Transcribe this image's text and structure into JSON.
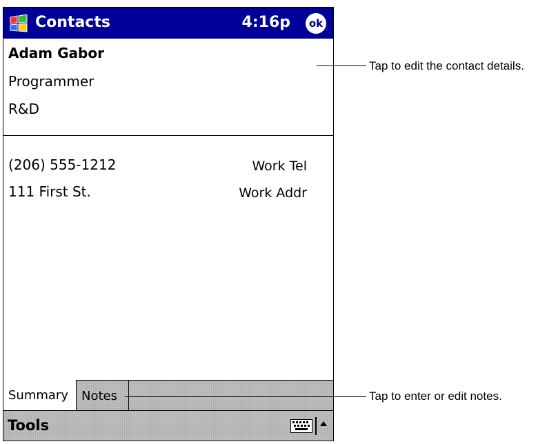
{
  "titlebar": {
    "app_title": "Contacts",
    "time": "4:16p",
    "ok_label": "ok"
  },
  "contact": {
    "name": "Adam Gabor",
    "job_title": "Programmer",
    "department": "R&D"
  },
  "fields": [
    {
      "value": "(206) 555-1212",
      "label": "Work Tel"
    },
    {
      "value": "111 First St.",
      "label": "Work Addr"
    }
  ],
  "tabs": [
    {
      "label": "Summary",
      "selected": true
    },
    {
      "label": "Notes",
      "selected": false
    }
  ],
  "command_bar": {
    "tools_label": "Tools",
    "keyboard_icon": "keyboard-icon",
    "arrow_icon": "up-arrow-icon"
  },
  "callouts": [
    {
      "text": "Tap to edit the contact details."
    },
    {
      "text": "Tap to enter or edit notes."
    }
  ],
  "colors": {
    "titlebar": "#000099",
    "bar_gray": "#c0c0c0"
  }
}
